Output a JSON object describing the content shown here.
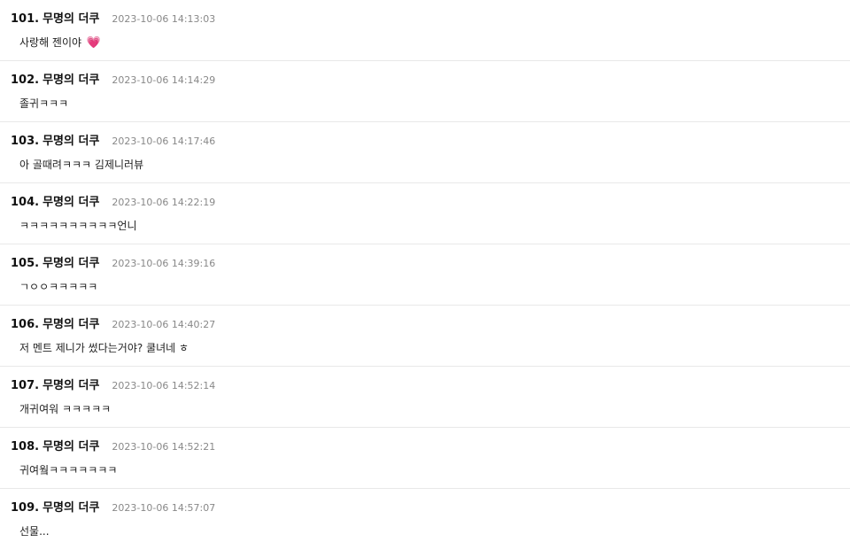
{
  "comments": [
    {
      "number": "101.",
      "author": "무명의 더쿠",
      "date": "2023-10-06 14:13:03",
      "text": "사랑해 젠이야",
      "emoji": "💗"
    },
    {
      "number": "102.",
      "author": "무명의 더쿠",
      "date": "2023-10-06 14:14:29",
      "text": "졸귀ㅋㅋㅋ"
    },
    {
      "number": "103.",
      "author": "무명의 더쿠",
      "date": "2023-10-06 14:17:46",
      "text": "아 골때려ㅋㅋㅋ 김제니러뷰"
    },
    {
      "number": "104.",
      "author": "무명의 더쿠",
      "date": "2023-10-06 14:22:19",
      "text": "ㅋㅋㅋㅋㅋㅋㅋㅋㅋㅋ언니"
    },
    {
      "number": "105.",
      "author": "무명의 더쿠",
      "date": "2023-10-06 14:39:16",
      "text": "ㄱㅇㅇㅋㅋㅋㅋㅋ"
    },
    {
      "number": "106.",
      "author": "무명의 더쿠",
      "date": "2023-10-06 14:40:27",
      "text": "저 멘트 제니가 썼다는거야? 쿨녀네 ㅎ"
    },
    {
      "number": "107.",
      "author": "무명의 더쿠",
      "date": "2023-10-06 14:52:14",
      "text": "개귀여워 ㅋㅋㅋㅋㅋ"
    },
    {
      "number": "108.",
      "author": "무명의 더쿠",
      "date": "2023-10-06 14:52:21",
      "text": "귀여웤ㅋㅋㅋㅋㅋㅋㅋ"
    },
    {
      "number": "109.",
      "author": "무명의 더쿠",
      "date": "2023-10-06 14:57:07",
      "text": "선물..."
    }
  ],
  "colors": {
    "heart": "#e8458b",
    "divider": "#e8e8e8",
    "date": "#888888"
  }
}
